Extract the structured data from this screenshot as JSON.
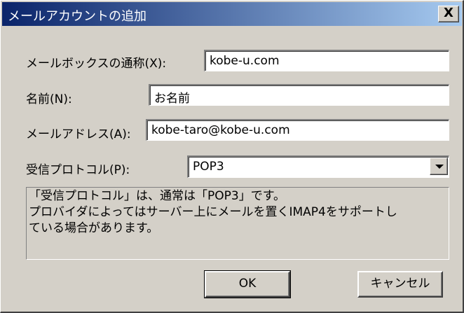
{
  "dialog": {
    "title": "メールアカウントの追加",
    "close_label": "X"
  },
  "form": {
    "mailbox": {
      "label": "メールボックスの通称(X):",
      "value": "kobe-u.com"
    },
    "name": {
      "label": "名前(N):",
      "value": "お名前"
    },
    "address": {
      "label": "メールアドレス(A):",
      "value": "kobe-taro@kobe-u.com"
    },
    "protocol": {
      "label": "受信プロトコル(P):",
      "value": "POP3"
    }
  },
  "info": {
    "lines": [
      "「受信プロトコル」は、通常は「POP3」です。",
      "プロバイダによってはサーバー上にメールを置くIMAP4をサポートし",
      "ている場合があります。"
    ]
  },
  "buttons": {
    "ok_label": "OK",
    "cancel_label": "キャンセル"
  },
  "icons": {
    "close": "close-icon",
    "dropdown": "chevron-down-icon"
  },
  "colors": {
    "titlebar_start": "#0a246a",
    "titlebar_end": "#a6caf0",
    "dialog_bg": "#d4d0c8"
  }
}
